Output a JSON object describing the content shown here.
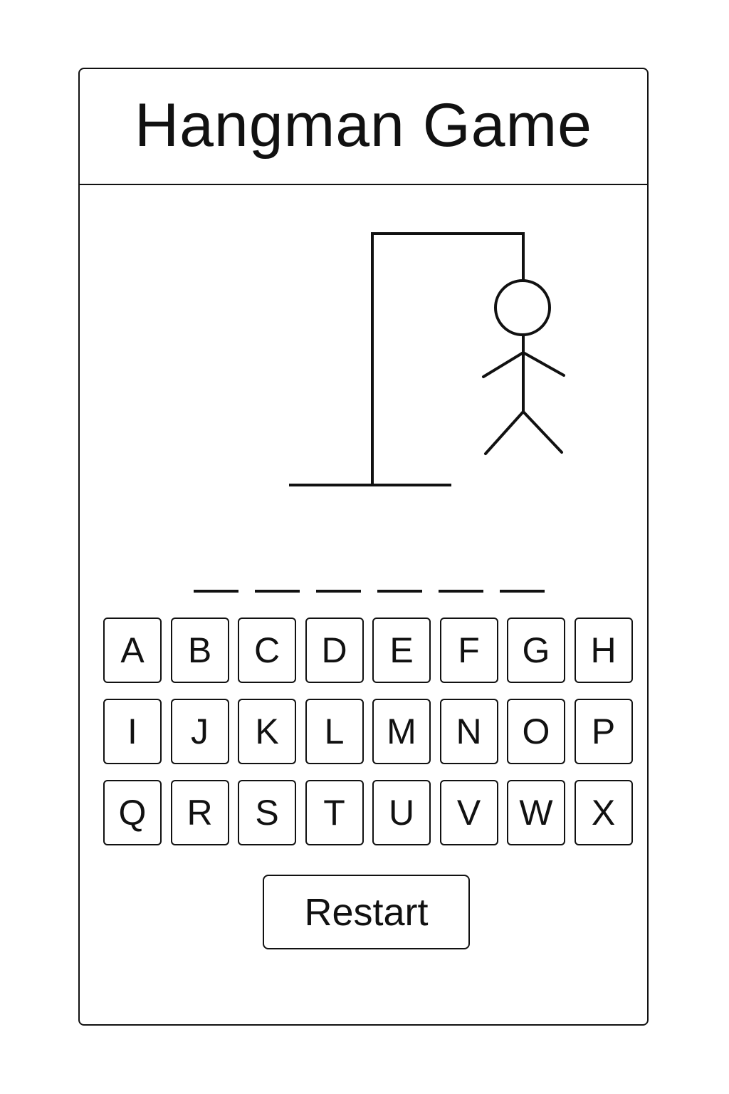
{
  "header": {
    "title": "Hangman Game"
  },
  "game": {
    "word_slots": [
      "",
      "",
      "",
      "",
      "",
      ""
    ],
    "drawn_parts": [
      "base",
      "post",
      "beam",
      "rope",
      "head",
      "body",
      "left-arm",
      "right-arm",
      "left-leg",
      "right-leg"
    ]
  },
  "keyboard": {
    "keys": [
      "A",
      "B",
      "C",
      "D",
      "E",
      "F",
      "G",
      "H",
      "I",
      "J",
      "K",
      "L",
      "M",
      "N",
      "O",
      "P",
      "Q",
      "R",
      "S",
      "T",
      "U",
      "V",
      "W",
      "X"
    ]
  },
  "actions": {
    "restart_label": "Restart"
  },
  "colors": {
    "line": "#111111",
    "background": "#ffffff"
  }
}
